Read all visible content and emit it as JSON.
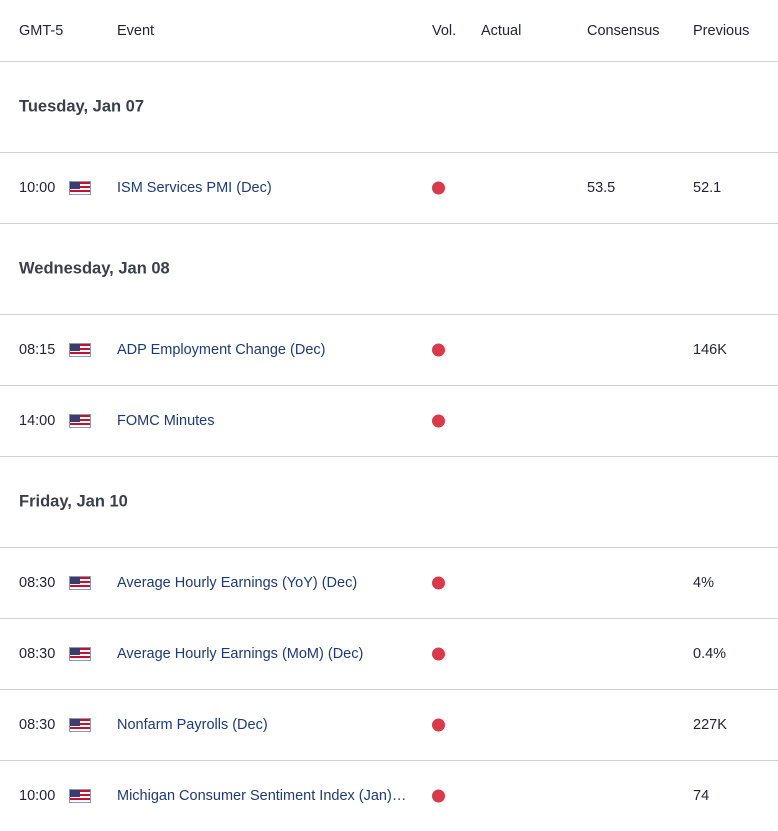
{
  "header": {
    "time": "GMT-5",
    "event": "Event",
    "vol": "Vol.",
    "actual": "Actual",
    "consensus": "Consensus",
    "previous": "Previous"
  },
  "colors": {
    "high_volatility": "#d93a4a",
    "event_text": "#1f3b73",
    "divider": "#cfd2d8"
  },
  "days": [
    {
      "label": "Tuesday, Jan 07",
      "events": [
        {
          "time": "10:00",
          "country_icon": "us-flag-icon",
          "event": "ISM Services PMI (Dec)",
          "volatility": "high",
          "actual": "",
          "consensus": "53.5",
          "previous": "52.1"
        }
      ]
    },
    {
      "label": "Wednesday, Jan 08",
      "events": [
        {
          "time": "08:15",
          "country_icon": "us-flag-icon",
          "event": "ADP Employment Change (Dec)",
          "volatility": "high",
          "actual": "",
          "consensus": "",
          "previous": "146K"
        },
        {
          "time": "14:00",
          "country_icon": "us-flag-icon",
          "event": "FOMC Minutes",
          "volatility": "high",
          "actual": "",
          "consensus": "",
          "previous": ""
        }
      ]
    },
    {
      "label": "Friday, Jan 10",
      "events": [
        {
          "time": "08:30",
          "country_icon": "us-flag-icon",
          "event": "Average Hourly Earnings (YoY) (Dec)",
          "volatility": "high",
          "actual": "",
          "consensus": "",
          "previous": "4%"
        },
        {
          "time": "08:30",
          "country_icon": "us-flag-icon",
          "event": "Average Hourly Earnings (MoM) (Dec)",
          "volatility": "high",
          "actual": "",
          "consensus": "",
          "previous": "0.4%"
        },
        {
          "time": "08:30",
          "country_icon": "us-flag-icon",
          "event": "Nonfarm Payrolls (Dec)",
          "volatility": "high",
          "actual": "",
          "consensus": "",
          "previous": "227K"
        },
        {
          "time": "10:00",
          "country_icon": "us-flag-icon",
          "event": "Michigan Consumer Sentiment Index (Jan)…",
          "volatility": "high",
          "actual": "",
          "consensus": "",
          "previous": "74"
        }
      ]
    }
  ]
}
